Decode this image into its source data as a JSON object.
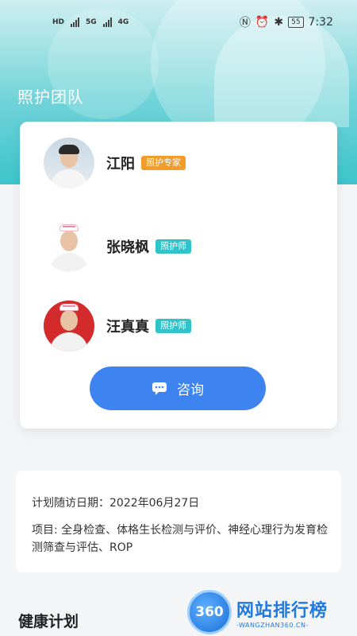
{
  "status_bar": {
    "net1": "HD",
    "net2": "HD",
    "sig1": "5G",
    "sig2": "4G",
    "battery": "55",
    "time": "7:32"
  },
  "header": {
    "title": "照护团队"
  },
  "team": {
    "members": [
      {
        "name": "江阳",
        "role": "照护专家",
        "badge_color": "#f29c2a"
      },
      {
        "name": "张晓枫",
        "role": "照护师",
        "badge_color": "#30c3c9"
      },
      {
        "name": "汪真真",
        "role": "照护师",
        "badge_color": "#30c3c9"
      }
    ],
    "consult_label": "咨询",
    "consult_icon": "chat-icon"
  },
  "plan_info": {
    "followup_date": "计划随访日期：2022年06月27日",
    "items": "项目: 全身检查、体格生长检测与评价、神经心理行为发育检测筛查与评估、ROP"
  },
  "health_plan": {
    "title": "健康计划"
  },
  "watermark": {
    "logo": "360",
    "main": "网站排行榜",
    "sub": "-WANGZHAN360.CN-"
  },
  "colors": {
    "accent": "#3d84f1",
    "hero": "#3cc4cb",
    "orange": "#f29c2a",
    "teal": "#30c3c9"
  }
}
